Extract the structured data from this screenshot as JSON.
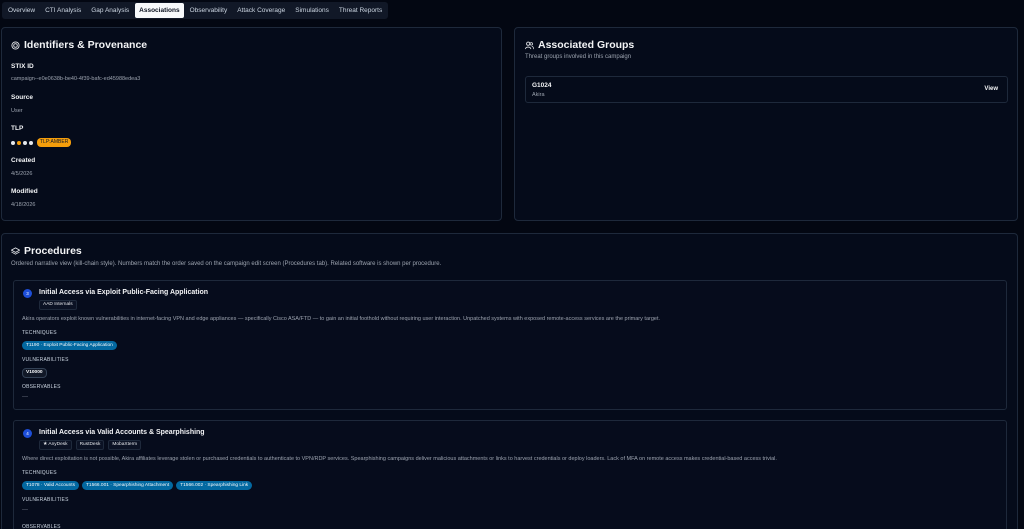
{
  "tabs": [
    "Overview",
    "CTI Analysis",
    "Gap Analysis",
    "Associations",
    "Observability",
    "Attack Coverage",
    "Simulations",
    "Threat Reports"
  ],
  "active_tab": 3,
  "identifiers": {
    "title": "Identifiers & Provenance",
    "stix_label": "STIX ID",
    "stix_value": "campaign--e0e0638b-be40-4f39-bafc-ed45988edea3",
    "source_label": "Source",
    "source_value": "User",
    "tlp_label": "TLP",
    "tlp_badge": "TLP:AMBER",
    "tlp_dot_colors": [
      "#e5e7eb",
      "#f59e0b",
      "#e5e7eb",
      "#e5e7eb"
    ],
    "created_label": "Created",
    "created_value": "4/5/2026",
    "modified_label": "Modified",
    "modified_value": "4/18/2026"
  },
  "groups": {
    "title": "Associated Groups",
    "subtitle": "Threat groups involved in this campaign",
    "items": [
      {
        "id": "G1024",
        "name": "Akira",
        "action": "View"
      }
    ]
  },
  "procedures": {
    "title": "Procedures",
    "subtitle": "Ordered narrative view (kill-chain style). Numbers match the order saved on the campaign edit screen (Procedures tab). Related software is shown per procedure.",
    "techniques_label": "TECHNIQUES",
    "vulnerabilities_label": "VULNERABILITIES",
    "observables_label": "OBSERVABLES",
    "empty_value": "—",
    "items": [
      {
        "number": "3",
        "name": "Initial Access via Exploit Public-Facing Application",
        "software": [
          "AAD Internals"
        ],
        "description": "Akira operators exploit known vulnerabilities in internet-facing VPN and edge appliances — specifically Cisco ASA/FTD — to gain an initial foothold without requiring user interaction. Unpatched systems with exposed remote-access services are the primary target.",
        "techniques": [
          "T1190 · Exploit Public-Facing Application"
        ],
        "vulnerabilities": [
          "V10000"
        ]
      },
      {
        "number": "4",
        "name": "Initial Access via Valid Accounts & Spearphishing",
        "software": [
          "★ AnyDesk",
          "RustDesk",
          "MobaXterm"
        ],
        "description": "Where direct exploitation is not possible, Akira affiliates leverage stolen or purchased credentials to authenticate to VPN/RDP services. Spearphishing campaigns deliver malicious attachments or links to harvest credentials or deploy loaders. Lack of MFA on remote access makes credential-based access trivial.",
        "techniques": [
          "T1078 · Valid Accounts",
          "T1566.001 · Spearphishing Attachment",
          "T1566.002 · Spearphishing Link"
        ],
        "vulnerabilities": []
      }
    ]
  },
  "colors": {
    "background": "#030712",
    "panel": "#050b1a",
    "accent": "#0369a1",
    "tlp_amber": "#f59e0b"
  }
}
